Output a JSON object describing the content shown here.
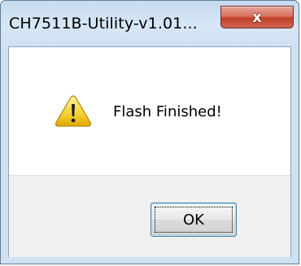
{
  "window": {
    "title": "CH7511B-Utility-v1.01...",
    "close_label": "x"
  },
  "dialog": {
    "icon": "warning-icon",
    "message": "Flash Finished!",
    "ok_label": "OK"
  },
  "colors": {
    "close_red": "#c0412a",
    "title_bar": "#cfe1f3",
    "footer_bg": "#f0f0f0"
  }
}
